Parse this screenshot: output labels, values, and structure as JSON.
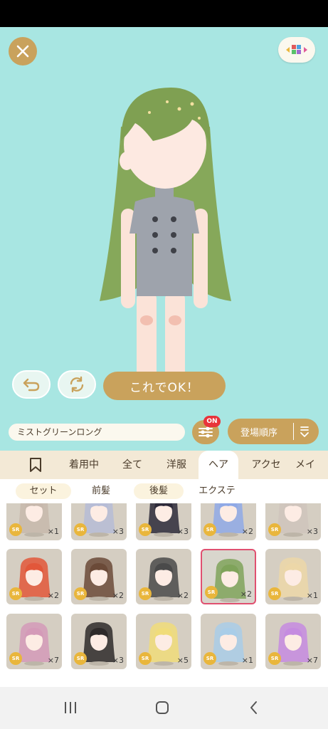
{
  "outfit_name": "ミストグリーンロング",
  "ok_button": "これでOK！",
  "filter_badge": "ON",
  "sort_label": "登場順序",
  "tabs": [
    "着用中",
    "全て",
    "洋服",
    "ヘア",
    "アクセ",
    "メイ"
  ],
  "subtabs": [
    "セット",
    "前髪",
    "後髪",
    "エクステ"
  ],
  "rarity_label": "SR",
  "grid": [
    {
      "count": "×1",
      "hair": "#c7b8ac"
    },
    {
      "count": "×3",
      "hair": "#b6bcd6"
    },
    {
      "count": "×3",
      "hair": "#2d2a3a"
    },
    {
      "count": "×2",
      "hair": "#8fa9e6"
    },
    {
      "count": "×3",
      "hair": "#cfc4bc"
    },
    {
      "count": "×2",
      "hair": "#e2573a"
    },
    {
      "count": "×2",
      "hair": "#6b4a38"
    },
    {
      "count": "×2",
      "hair": "#4a4a4a"
    },
    {
      "count": "×2",
      "hair": "#7fa35a"
    },
    {
      "count": "×1",
      "hair": "#ecd7a8"
    },
    {
      "count": "×7",
      "hair": "#d49ab8"
    },
    {
      "count": "×3",
      "hair": "#2e2a2a"
    },
    {
      "count": "×5",
      "hair": "#f0dc7a"
    },
    {
      "count": "×1",
      "hair": "#a9cde8"
    },
    {
      "count": "×7",
      "hair": "#c58be0"
    }
  ],
  "colors": {
    "stage": "#a8e6e2",
    "gold": "#c9a25c",
    "selected_border": "#e05070"
  }
}
